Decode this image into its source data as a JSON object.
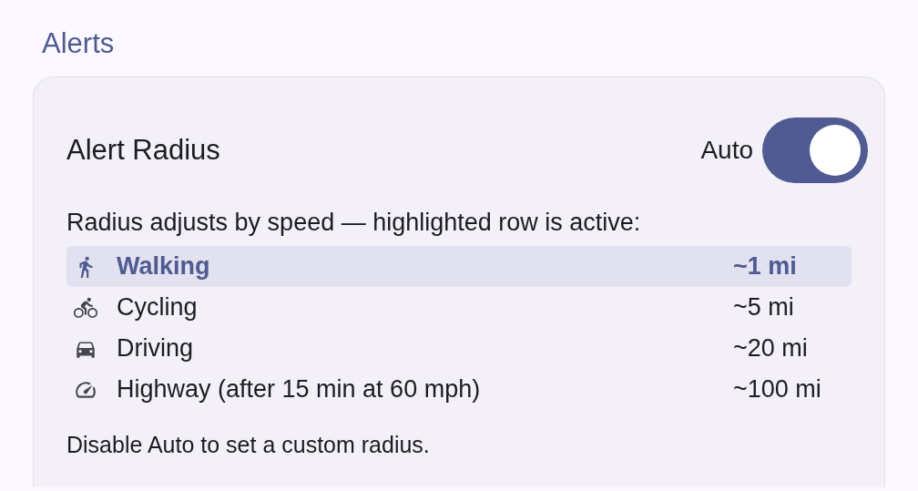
{
  "section_title": "Alerts",
  "card": {
    "title": "Alert Radius",
    "auto_label": "Auto",
    "auto_on": true,
    "intro": "Radius adjusts by speed — highlighted row is active:",
    "rows": [
      {
        "kind": "walk",
        "label": "Walking",
        "value": "~1 mi",
        "selected": true
      },
      {
        "kind": "bike",
        "label": "Cycling",
        "value": "~5 mi",
        "selected": false
      },
      {
        "kind": "car",
        "label": "Driving",
        "value": "~20 mi",
        "selected": false
      },
      {
        "kind": "speed",
        "label": "Highway (after 15 min at 60 mph)",
        "value": "~100 mi",
        "selected": false
      }
    ],
    "note": "Disable Auto to set a custom radius."
  }
}
